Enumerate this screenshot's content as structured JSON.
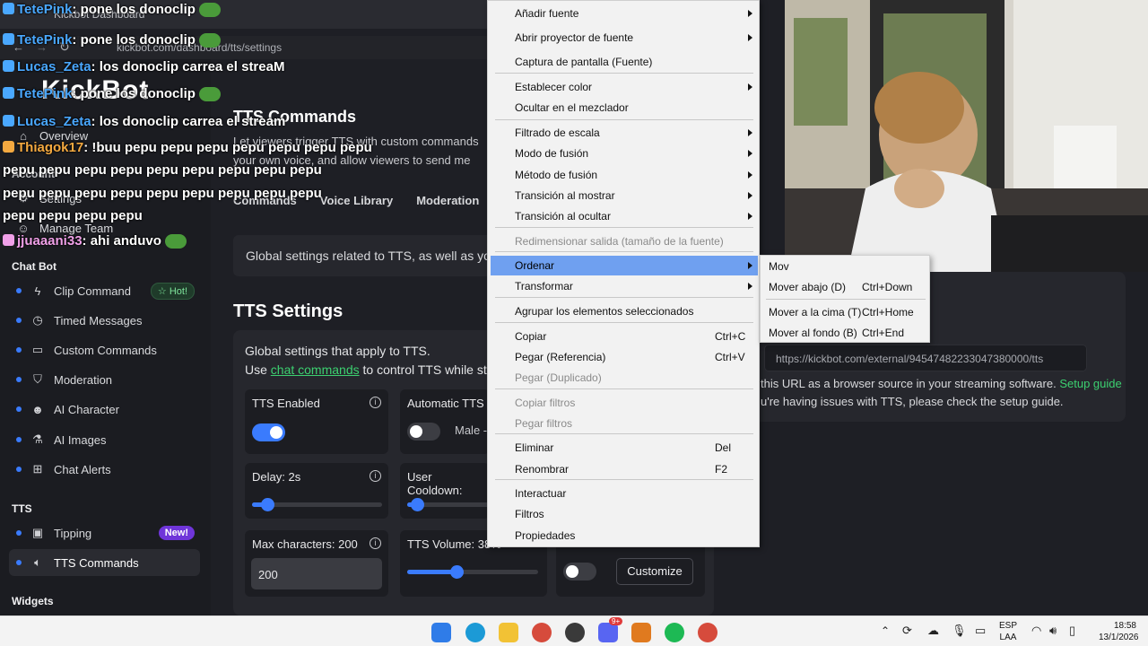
{
  "browser": {
    "tab_title": "Kickbot Dashboard",
    "url": "kickbot.com/dashboard/tts/settings"
  },
  "brand": "KickBot",
  "sidebar": {
    "top_items": [
      {
        "label": "Overview",
        "icon": "home-icon"
      },
      {
        "label": "Settings",
        "icon": "gear-icon"
      },
      {
        "label": "Manage Team",
        "icon": "team-icon"
      }
    ],
    "section_account": "Account",
    "section_chatbot": "Chat Bot",
    "chatbot_items": [
      {
        "label": "Clip Command",
        "icon": "bolt-icon",
        "badge": "☆ Hot!"
      },
      {
        "label": "Timed Messages",
        "icon": "clock-icon"
      },
      {
        "label": "Custom Commands",
        "icon": "tag-icon"
      },
      {
        "label": "Moderation",
        "icon": "shield-icon"
      },
      {
        "label": "AI Character",
        "icon": "character-icon"
      },
      {
        "label": "AI Images",
        "icon": "flask-icon"
      },
      {
        "label": "Chat Alerts",
        "icon": "gift-icon"
      }
    ],
    "section_tts": "TTS",
    "tts_items": [
      {
        "label": "Tipping",
        "icon": "tip-icon",
        "badge": "New!"
      },
      {
        "label": "TTS Commands",
        "icon": "speaker-icon"
      }
    ],
    "section_widgets": "Widgets"
  },
  "main": {
    "page_title": "TTS Commands",
    "desc_line1": "Let viewers trigger TTS with custom commands",
    "desc_line2": "your own voice, and allow viewers to send me",
    "tabs": [
      "Commands",
      "Voice Library",
      "Moderation"
    ],
    "global_card": "Global settings related to TTS, as well as yo",
    "tts_settings_title": "TTS Settings",
    "tts_desc1": "Global settings that apply to TTS.",
    "tts_desc2_pre": "Use",
    "tts_desc2_link": "chat commands",
    "tts_desc2_post": "to control TTS while st",
    "cards": {
      "tts_enabled": "TTS Enabled",
      "automatic_tts": "Automatic TTS",
      "voice_select": "Male -",
      "delay": "Delay: 2s",
      "user_cooldown": "User Cooldown:",
      "max_chars": "Max characters: 200",
      "max_chars_value": "200",
      "tts_volume": "TTS Volume: 38%",
      "customize": "Customize"
    },
    "levels": {
      "delay": 0.12,
      "user_cooldown": 0.12,
      "tts_volume": 0.38
    },
    "toggles": {
      "tts_enabled": true,
      "automatic_tts": false,
      "third": false
    }
  },
  "right_panel": {
    "ext_url": "https://kickbot.com/external/94547482233047380000/tts",
    "info1_pre": "this URL as a browser source in your streaming software.",
    "info1_link": "Setup guide",
    "info2": "u're having issues with TTS, please check the setup guide."
  },
  "chat_overlay": [
    {
      "user": "TetePink",
      "text": ": pone los donoclip",
      "color": "#4aa8ff"
    },
    {
      "user": "TetePink",
      "text": ": pone los donoclip",
      "color": "#4aa8ff"
    },
    {
      "user": "Lucas_Zeta",
      "text": ": los donoclip carrea el streaM",
      "color": "#4aa8ff"
    },
    {
      "user": "TetePink",
      "text": ": pone los donoclip",
      "color": "#4aa8ff"
    },
    {
      "user": "Lucas_Zeta",
      "text": ": los donoclip carrea el stream",
      "color": "#4aa8ff"
    },
    {
      "user": "Thiagok17",
      "text": ": !buu pepu pepu pepu pepu pepu pepu pepu",
      "color": "#f4a940"
    },
    {
      "user": "",
      "text": "pepu pepu pepu pepu pepu pepu pepu pepu pepu",
      "color": "#ffffff"
    },
    {
      "user": "",
      "text": "pepu pepu pepu pepu pepu pepu pepu pepu pepu",
      "color": "#ffffff"
    },
    {
      "user": "",
      "text": "pepu pepu pepu pepu",
      "color": "#ffffff"
    },
    {
      "user": "jjuaaani33",
      "text": ": ahi anduvo",
      "color": "#f0a0e8"
    }
  ],
  "context_menu": [
    {
      "label": "Añadir fuente",
      "submenu": true
    },
    {
      "label": "Abrir proyector de fuente",
      "submenu": true
    },
    {
      "label": "Captura de pantalla (Fuente)"
    },
    {
      "label": "Establecer color",
      "submenu": true
    },
    {
      "label": "Ocultar en el mezclador"
    },
    {
      "label": "Filtrado de escala",
      "submenu": true
    },
    {
      "label": "Modo de fusión",
      "submenu": true
    },
    {
      "label": "Método de fusión",
      "submenu": true
    },
    {
      "label": "Transición al mostrar",
      "submenu": true
    },
    {
      "label": "Transición al ocultar",
      "submenu": true
    },
    {
      "label": "Redimensionar salida (tamaño de la fuente)",
      "disabled": true
    },
    {
      "label": "Ordenar",
      "submenu": true,
      "selected": true
    },
    {
      "label": "Transformar",
      "submenu": true
    },
    {
      "label": "Agrupar los elementos seleccionados"
    },
    {
      "label": "Copiar",
      "shortcut": "Ctrl+C"
    },
    {
      "label": "Pegar (Referencia)",
      "shortcut": "Ctrl+V"
    },
    {
      "label": "Pegar (Duplicado)",
      "disabled": true
    },
    {
      "label": "Copiar filtros",
      "disabled": true
    },
    {
      "label": "Pegar filtros",
      "disabled": true
    },
    {
      "label": "Eliminar",
      "shortcut": "Del"
    },
    {
      "label": "Renombrar",
      "shortcut": "F2"
    },
    {
      "label": "Interactuar"
    },
    {
      "label": "Filtros"
    },
    {
      "label": "Propiedades"
    }
  ],
  "submenu": [
    {
      "label": "Mov",
      "shortcut": ""
    },
    {
      "label": "Mover abajo (D)",
      "shortcut": "Ctrl+Down"
    },
    {
      "label": "Mover a la cima (T)",
      "shortcut": "Ctrl+Home"
    },
    {
      "label": "Mover al fondo (B)",
      "shortcut": "Ctrl+End"
    }
  ],
  "taskbar": {
    "lang1": "ESP",
    "lang2": "LAA",
    "time": "18:58",
    "date": "13/1/2026",
    "notif_badge": "9+"
  }
}
